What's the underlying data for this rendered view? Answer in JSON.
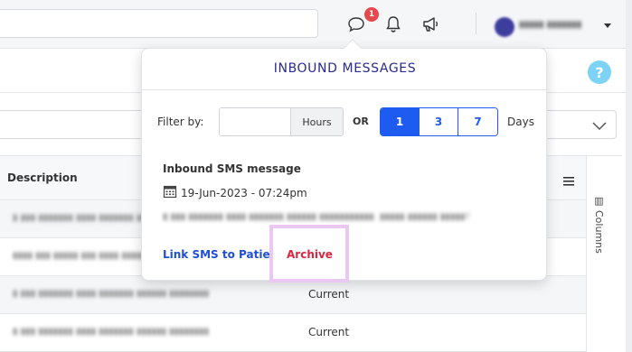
{
  "topbar": {
    "chat_badge_count": "1",
    "icons": [
      "chat-bubble-icon",
      "bell-icon",
      "megaphone-icon"
    ]
  },
  "table": {
    "header_description": "Description",
    "rows": [
      {
        "status": ""
      },
      {
        "status": ""
      },
      {
        "status": "Current"
      },
      {
        "status": "Current"
      }
    ],
    "columns_tab_label": "Columns"
  },
  "popup": {
    "title": "INBOUND MESSAGES",
    "filter_label": "Filter by:",
    "hours_value": "",
    "hours_addon": "Hours",
    "or_label": "OR",
    "day_options": [
      "1",
      "3",
      "7"
    ],
    "selected_day": "1",
    "days_label": "Days",
    "message": {
      "type": "Inbound SMS message",
      "date": "19-Jun-2023 - 07:24pm",
      "link_label": "Link SMS to Patient",
      "archive_label": "Archive"
    }
  },
  "colors": {
    "primary_blue": "#1e5bf0",
    "title_navy": "#2a2a8f",
    "archive_red": "#d7263d",
    "badge_red": "#e5484d",
    "help_blue": "#7dd3f5",
    "highlight_pink": "#eac8f2"
  }
}
